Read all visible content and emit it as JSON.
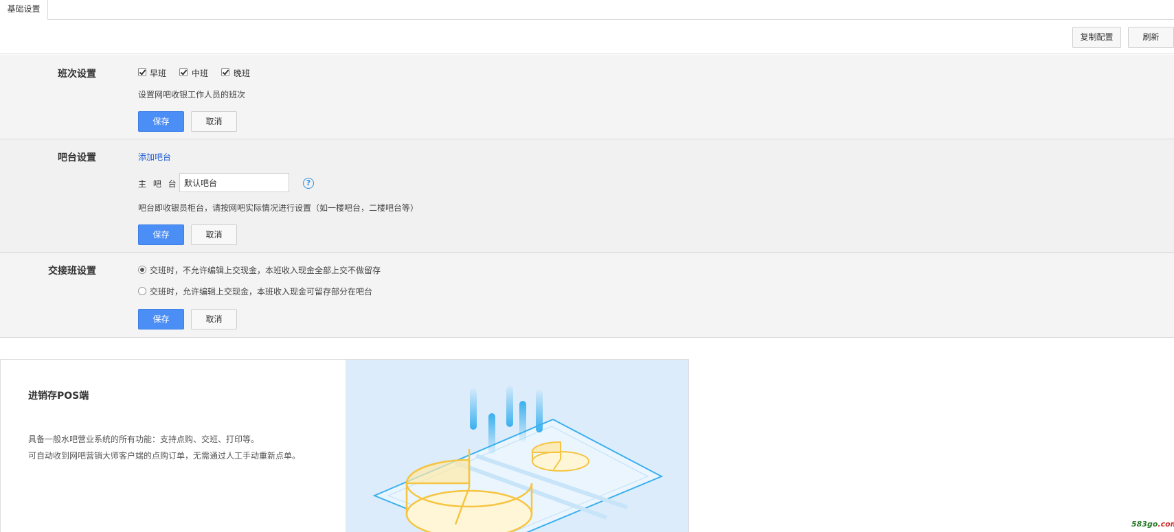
{
  "tabs": [
    {
      "label": "基础设置",
      "active": true
    }
  ],
  "toolbar": {
    "copy_config": "复制配置",
    "refresh": "刷新"
  },
  "shift_section": {
    "title": "班次设置",
    "options": [
      {
        "label": "早班",
        "checked": true
      },
      {
        "label": "中班",
        "checked": true
      },
      {
        "label": "晚班",
        "checked": true
      }
    ],
    "hint": "设置网吧收银工作人员的班次",
    "save": "保存",
    "cancel": "取消"
  },
  "bar_section": {
    "title": "吧台设置",
    "add_link": "添加吧台",
    "main_bar_label": "主 吧 台 :",
    "main_bar_value": "默认吧台",
    "help": "?",
    "hint": "吧台即收银员柜台，请按网吧实际情况进行设置（如一楼吧台，二楼吧台等）",
    "save": "保存",
    "cancel": "取消"
  },
  "handover_section": {
    "title": "交接班设置",
    "options": [
      {
        "label": "交班时，不允许编辑上交现金，本班收入现金全部上交不做留存",
        "selected": true
      },
      {
        "label": "交班时，允许编辑上交现金，本班收入现金可留存部分在吧台",
        "selected": false
      }
    ],
    "save": "保存",
    "cancel": "取消"
  },
  "promo": {
    "title": "进销存POS端",
    "lines": [
      "具备一般水吧营业系统的所有功能：支持点购、交班、打印等。",
      "可自动收到网吧营销大师客户端的点购订单，无需通过人工手动重新点单。"
    ]
  },
  "watermark": {
    "main": "583go",
    "suffix": ".com"
  },
  "colors": {
    "primary": "#4b8ef5",
    "section_bg": "#f4f4f4",
    "link": "#1f5fd3",
    "art_bg": "#dcecfb",
    "art_yellow": "#f5c542",
    "art_blue": "#3ab0ee"
  }
}
